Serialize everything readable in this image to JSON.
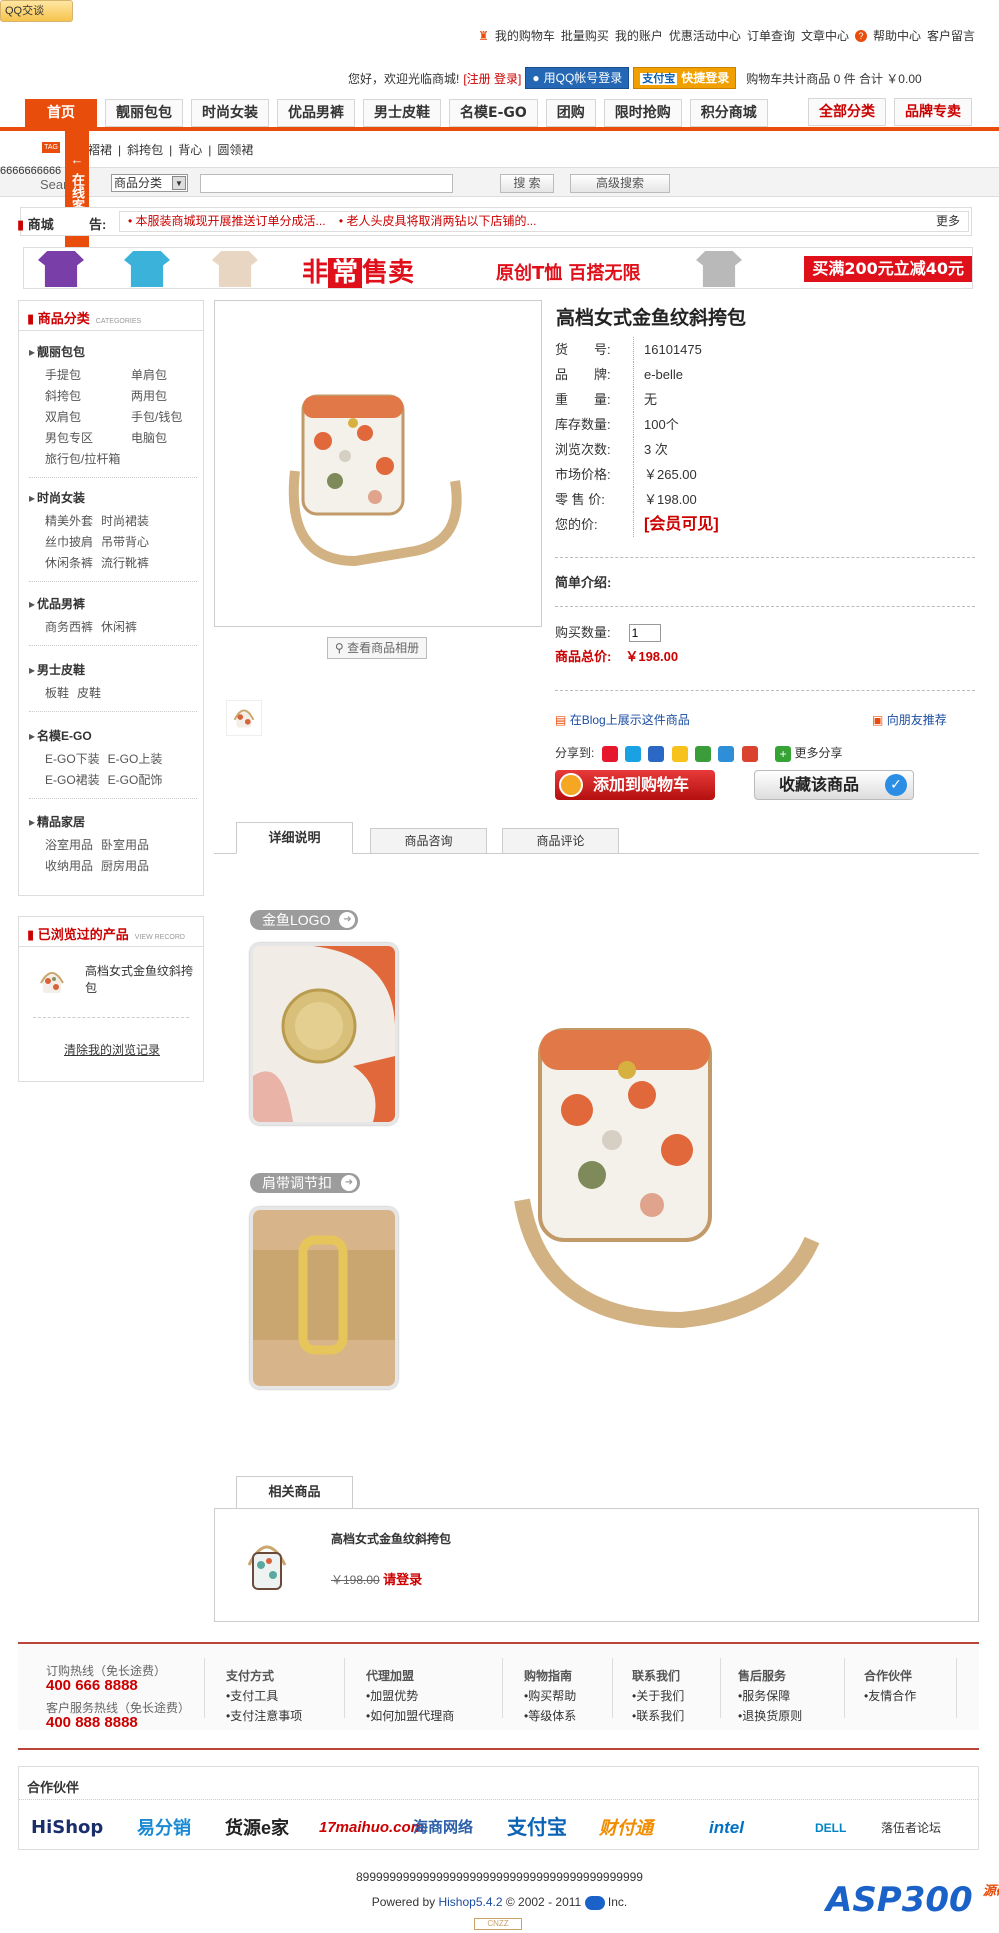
{
  "top": {
    "qq_badge": "QQ交谈",
    "links": [
      "我的购物车",
      "批量购买",
      "我的账户",
      "优惠活动中心",
      "订单查询",
      "文章中心",
      "帮助中心",
      "客户留言"
    ],
    "welcome": "您好，欢迎光临商城!",
    "register_login": "[注册 登录]",
    "qq_login": "用QQ帐号登录",
    "alipay_label": "支付宝",
    "alipay_quick": "快捷登录",
    "cart_summary": "购物车共计商品 0 件 合计 ￥0.00"
  },
  "nav": {
    "items": [
      "首页",
      "靓丽包包",
      "时尚女装",
      "优品男裤",
      "男士皮鞋",
      "名模E-GO",
      "团购",
      "限时抢购",
      "积分商城"
    ],
    "right_items": [
      "全部分类",
      "品牌专卖"
    ]
  },
  "tags": {
    "icon": "TAG",
    "items": [
      "褶裙",
      "斜挎包",
      "背心",
      "圆领裙"
    ],
    "first_partial": "褶裙"
  },
  "kefu": "在线客服",
  "search": {
    "sixes": "6666666666",
    "label": "Search",
    "category": "商品分类",
    "query": "",
    "search_btn": "搜 索",
    "advanced_btn": "高级搜索"
  },
  "notice": {
    "label": "商城",
    "label_suffix": "告:",
    "items": [
      "本服装商城现开展推送订单分成活...",
      "老人头皮具将取消两钻以下店铺的..."
    ],
    "more": "更多"
  },
  "banner": {
    "prefix": "非",
    "highlight": "常",
    "suffix": "售卖",
    "subtitle": "原创T恤  百搭无限",
    "cta": "买满200元立减40元",
    "colors": [
      "#7a3ea8",
      "#3ab2d9",
      "#e9d6c2",
      "#b9b9b9"
    ]
  },
  "sidebar": {
    "title": "商品分类",
    "title_en": "CATEGORIES",
    "categories": [
      {
        "name": "靓丽包包",
        "items": [
          "手提包",
          "单肩包",
          "斜挎包",
          "两用包",
          "双肩包",
          "手包/钱包",
          "男包专区",
          "电脑包",
          "旅行包/拉杆箱"
        ]
      },
      {
        "name": "时尚女装",
        "items": [
          "精美外套",
          "时尚裙装",
          "丝巾披肩",
          "吊带背心",
          "休闲条裤",
          "流行靴裤"
        ]
      },
      {
        "name": "优品男裤",
        "items": [
          "商务西裤",
          "休闲裤"
        ]
      },
      {
        "name": "男士皮鞋",
        "items": [
          "板鞋",
          "皮鞋"
        ]
      },
      {
        "name": "名模E-GO",
        "items": [
          "E-GO下装",
          "E-GO上装",
          "E-GO裙装",
          "E-GO配饰"
        ]
      },
      {
        "name": "精品家居",
        "items": [
          "浴室用品",
          "卧室用品",
          "收纳用品",
          "厨房用品"
        ]
      }
    ],
    "viewed_title": "已浏览过的产品",
    "viewed_en": "VIEW RECORD",
    "viewed_item": "高档女式金鱼纹斜挎包",
    "clear_link": "清除我的浏览记录"
  },
  "product": {
    "title": "高档女式金鱼纹斜挎包",
    "gallery_btn": "查看商品相册",
    "fields": [
      {
        "k": "货　　号:",
        "v": "16101475"
      },
      {
        "k": "品　　牌:",
        "v": "e-belle"
      },
      {
        "k": "重　　量:",
        "v": "无"
      },
      {
        "k": "库存数量:",
        "v": "100个"
      },
      {
        "k": "浏览次数:",
        "v": "3 次"
      },
      {
        "k": "市场价格:",
        "v": "￥265.00"
      },
      {
        "k": "零 售 价:",
        "v": "￥198.00"
      }
    ],
    "your_price_label": "您的价:",
    "your_price": "[会员可见]",
    "summary_label": "简单介绍:",
    "qty_label": "购买数量:",
    "qty_value": "1",
    "total_label": "商品总价:",
    "total_value": "￥198.00",
    "blog_link": "在Blog上展示这件商品",
    "friend_link": "向朋友推荐",
    "share_label": "分享到:",
    "share_more": "更多分享",
    "add_cart": "添加到购物车",
    "favorite": "收藏该商品"
  },
  "tabs": [
    "详细说明",
    "商品咨询",
    "商品评论"
  ],
  "detail": {
    "label1": "金鱼LOGO",
    "label2": "肩带调节扣"
  },
  "related": {
    "tab": "相关商品",
    "name": "高档女式金鱼纹斜挎包",
    "old_price": "￥198.00",
    "login": "请登录"
  },
  "footer": {
    "hotline1_label": "订购热线（免长途费）",
    "hotline1": "400 666 8888",
    "hotline2_label": "客户服务热线（免长途费）",
    "hotline2": "400 888 8888",
    "columns": [
      {
        "h": "支付方式",
        "items": [
          "支付工具",
          "支付注意事项"
        ]
      },
      {
        "h": "代理加盟",
        "items": [
          "加盟优势",
          "如何加盟代理商"
        ]
      },
      {
        "h": "购物指南",
        "items": [
          "购买帮助",
          "等级体系"
        ]
      },
      {
        "h": "联系我们",
        "items": [
          "关于我们",
          "联系我们"
        ]
      },
      {
        "h": "售后服务",
        "items": [
          "服务保障",
          "退换货原则"
        ]
      },
      {
        "h": "合作伙伴",
        "items": [
          "友情合作"
        ]
      }
    ],
    "partners_title": "合作伙伴",
    "partners": [
      "HiShop",
      "易分销",
      "货源e家",
      "17maihuo.com",
      "海商网络",
      "支付宝",
      "财付通",
      "intel",
      "DELL",
      "落伍者论坛"
    ],
    "copy1": "8999999999999999999999999999999999999999999",
    "powered": "Powered by",
    "hishop": "Hishop5.4.2",
    "copyright": "© 2002 - 2011",
    "inc": "Inc.",
    "asp": "ASP300",
    "asp_sub": "源码",
    "cnzz": "CNZZ"
  }
}
